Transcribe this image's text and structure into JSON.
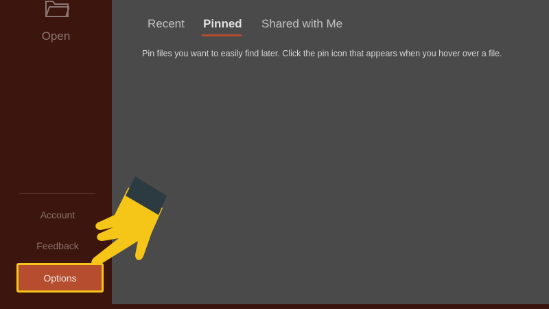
{
  "sidebar": {
    "open_label": "Open",
    "links": {
      "account": "Account",
      "feedback": "Feedback",
      "options": "Options"
    }
  },
  "tabs": [
    "Recent",
    "Pinned",
    "Shared with Me"
  ],
  "active_tab": "Pinned",
  "pinned_hint": "Pin files you want to easily find later. Click the pin icon that appears when you hover over a file.",
  "colors": {
    "sidebar": "#3c150e",
    "accent": "#b54d2e",
    "highlight": "#f5c518",
    "main": "#4a4a4a"
  },
  "icons": {
    "open": "folder-icon",
    "pointer": "pointing-hand-icon"
  }
}
